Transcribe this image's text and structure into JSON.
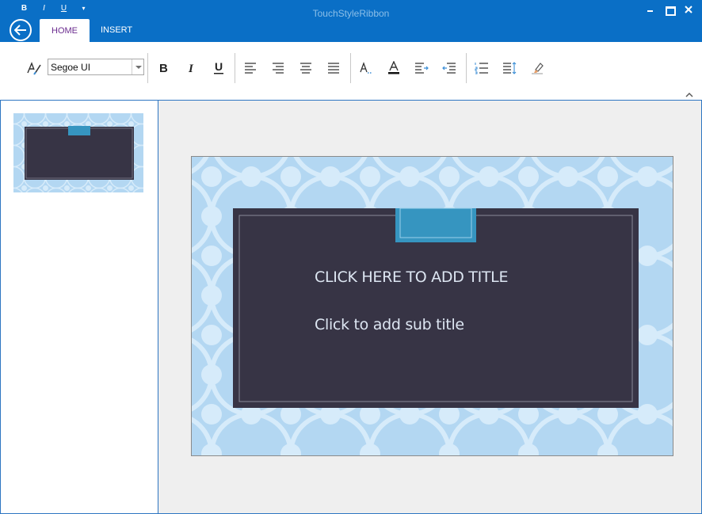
{
  "window": {
    "title": "TouchStyleRibbon"
  },
  "qat": {
    "bold": "B",
    "italic": "I",
    "underline": "U",
    "customize": "▾"
  },
  "tabs": [
    {
      "label": "HOME",
      "active": true
    },
    {
      "label": "INSERT",
      "active": false
    }
  ],
  "ribbon": {
    "font_name": "Segoe UI",
    "icons": [
      "format-painter-icon",
      "bold-icon",
      "italic-icon",
      "underline-icon",
      "align-left-icon",
      "align-right-icon",
      "align-center-icon",
      "justify-icon",
      "text-highlight-icon",
      "font-color-icon",
      "increase-indent-icon",
      "decrease-indent-icon",
      "numbered-list-icon",
      "line-spacing-icon",
      "clear-format-icon"
    ]
  },
  "slide": {
    "title_placeholder": "CLICK HERE TO ADD TITLE",
    "subtitle_placeholder": "Click to add sub title"
  },
  "colors": {
    "titlebar": "#0a6fc6",
    "slide_pattern_bg": "#b3d7f2",
    "slide_pattern_fg": "#d6ebfa",
    "slide_panel": "#373445",
    "slide_tab": "#3695c0",
    "tab_active_text": "#6b2c8f"
  }
}
